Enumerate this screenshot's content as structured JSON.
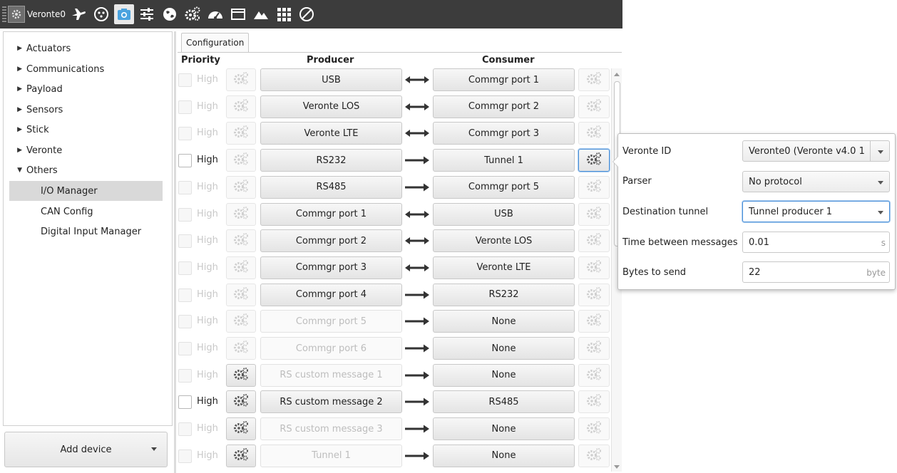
{
  "toolbar": {
    "device": "Veronte0",
    "icons": [
      "plane-icon",
      "radio-icon",
      "camera-icon",
      "sliders-icon",
      "globe-icon",
      "gears-icon",
      "dashboard-icon",
      "window-icon",
      "terrain-icon",
      "grid-icon",
      "disabled-icon"
    ]
  },
  "tree": {
    "items": [
      {
        "label": "Actuators",
        "expand": "collapsed"
      },
      {
        "label": "Communications",
        "expand": "collapsed"
      },
      {
        "label": "Payload",
        "expand": "collapsed"
      },
      {
        "label": "Sensors",
        "expand": "collapsed"
      },
      {
        "label": "Stick",
        "expand": "collapsed"
      },
      {
        "label": "Veronte",
        "expand": "collapsed"
      },
      {
        "label": "Others",
        "expand": "expanded"
      },
      {
        "label": "I/O Manager",
        "expand": "none",
        "selected": true
      },
      {
        "label": "CAN Config",
        "expand": "none"
      },
      {
        "label": "Digital Input Manager",
        "expand": "none"
      }
    ],
    "add_device": "Add device"
  },
  "tab": {
    "label": "Configuration"
  },
  "headers": {
    "priority": "Priority",
    "producer": "Producer",
    "consumer": "Consumer"
  },
  "rows": [
    {
      "high": "High",
      "enabled": false,
      "pgear": false,
      "producer": "USB",
      "pdis": false,
      "arrow": "bi",
      "consumer": "Commgr port 1",
      "cgear": false
    },
    {
      "high": "High",
      "enabled": false,
      "pgear": false,
      "producer": "Veronte LOS",
      "pdis": false,
      "arrow": "bi",
      "consumer": "Commgr port 2",
      "cgear": false
    },
    {
      "high": "High",
      "enabled": false,
      "pgear": false,
      "producer": "Veronte LTE",
      "pdis": false,
      "arrow": "bi",
      "consumer": "Commgr port 3",
      "cgear": false
    },
    {
      "high": "High",
      "enabled": true,
      "pgear": false,
      "producer": "RS232",
      "pdis": false,
      "arrow": "uni",
      "consumer": "Tunnel 1",
      "cgear": true
    },
    {
      "high": "High",
      "enabled": false,
      "pgear": false,
      "producer": "RS485",
      "pdis": false,
      "arrow": "uni",
      "consumer": "Commgr port 5",
      "cgear": false
    },
    {
      "high": "High",
      "enabled": false,
      "pgear": false,
      "producer": "Commgr port 1",
      "pdis": false,
      "arrow": "bi",
      "consumer": "USB",
      "cgear": false
    },
    {
      "high": "High",
      "enabled": false,
      "pgear": false,
      "producer": "Commgr port 2",
      "pdis": false,
      "arrow": "bi",
      "consumer": "Veronte LOS",
      "cgear": false
    },
    {
      "high": "High",
      "enabled": false,
      "pgear": false,
      "producer": "Commgr port 3",
      "pdis": false,
      "arrow": "bi",
      "consumer": "Veronte LTE",
      "cgear": false
    },
    {
      "high": "High",
      "enabled": false,
      "pgear": false,
      "producer": "Commgr port 4",
      "pdis": false,
      "arrow": "uni",
      "consumer": "RS232",
      "cgear": false
    },
    {
      "high": "High",
      "enabled": false,
      "pgear": false,
      "producer": "Commgr port 5",
      "pdis": true,
      "arrow": "uni",
      "consumer": "None",
      "cgear": false
    },
    {
      "high": "High",
      "enabled": false,
      "pgear": false,
      "producer": "Commgr port 6",
      "pdis": true,
      "arrow": "uni",
      "consumer": "None",
      "cgear": false
    },
    {
      "high": "High",
      "enabled": false,
      "pgear": true,
      "producer": "RS custom message 1",
      "pdis": true,
      "arrow": "uni",
      "consumer": "None",
      "cgear": false
    },
    {
      "high": "High",
      "enabled": true,
      "pgear": true,
      "producer": "RS custom message 2",
      "pdis": false,
      "arrow": "uni",
      "consumer": "RS485",
      "cgear": false
    },
    {
      "high": "High",
      "enabled": false,
      "pgear": true,
      "producer": "RS custom message 3",
      "pdis": true,
      "arrow": "uni",
      "consumer": "None",
      "cgear": false
    },
    {
      "high": "High",
      "enabled": false,
      "pgear": true,
      "producer": "Tunnel 1",
      "pdis": true,
      "arrow": "uni",
      "consumer": "None",
      "cgear": false
    }
  ],
  "popup": {
    "veronte_id": {
      "label": "Veronte ID",
      "value": "Veronte0 (Veronte v4.0 1"
    },
    "parser": {
      "label": "Parser",
      "value": "No protocol"
    },
    "destination": {
      "label": "Destination tunnel",
      "value": "Tunnel producer 1"
    },
    "time": {
      "label": "Time between messages",
      "value": "0.01",
      "unit": "s"
    },
    "bytes": {
      "label": "Bytes to send",
      "value": "22",
      "unit": "byte"
    }
  }
}
